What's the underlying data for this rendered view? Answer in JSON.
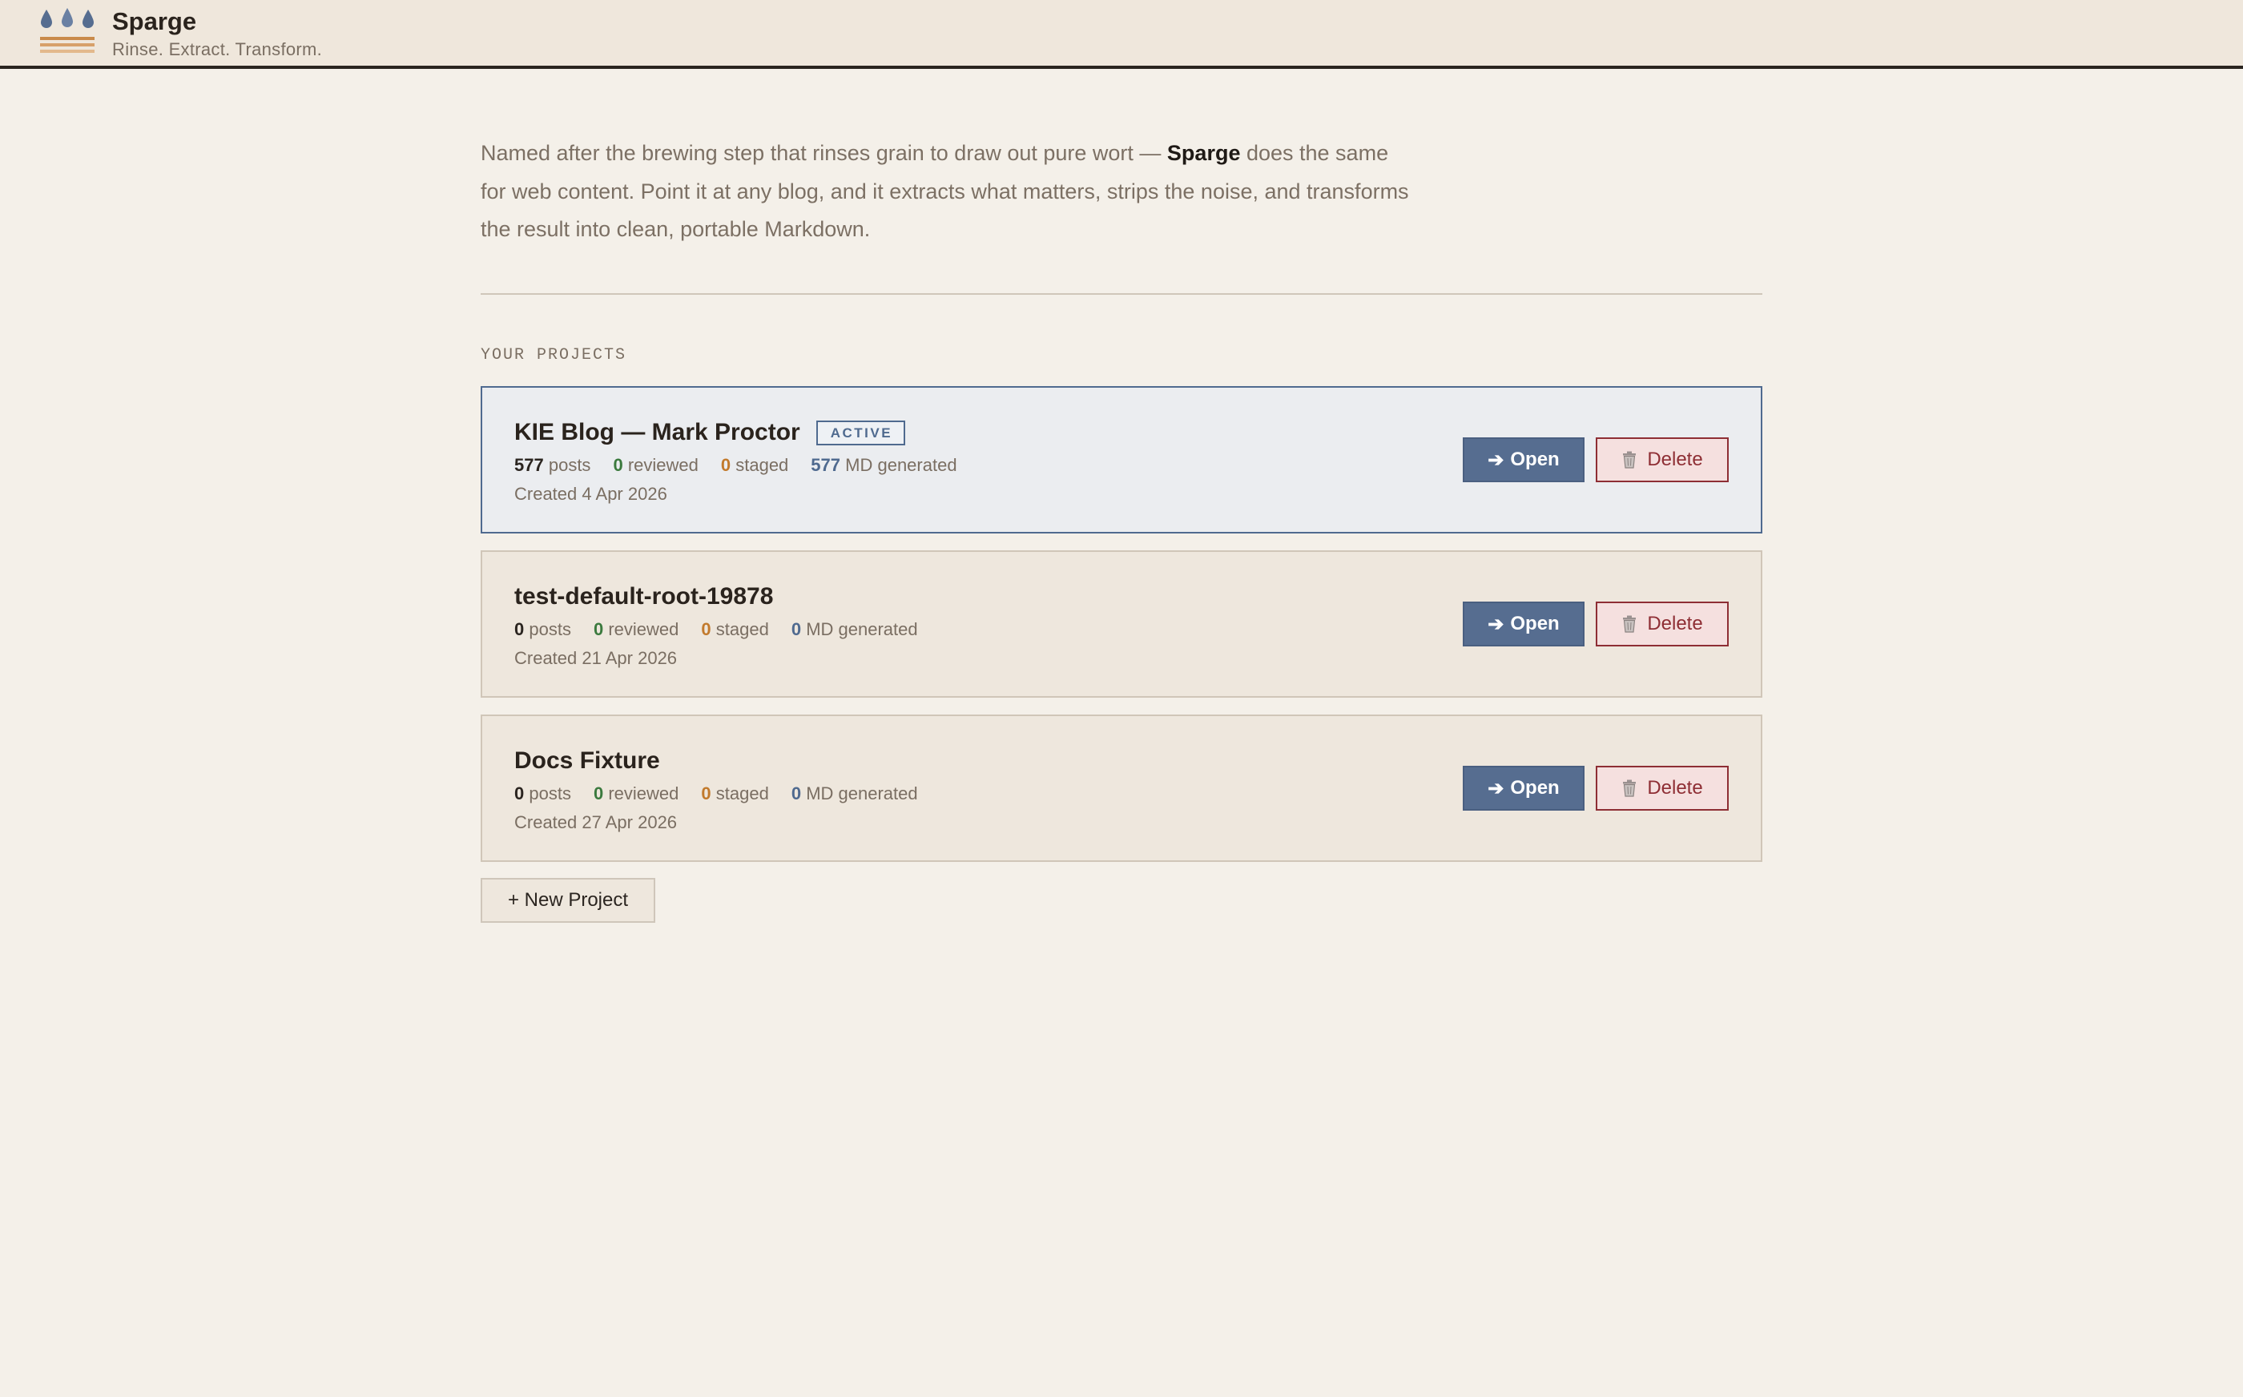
{
  "header": {
    "title": "Sparge",
    "tagline": "Rinse. Extract. Transform."
  },
  "intro": {
    "text_before": "Named after the brewing step that rinses grain to draw out pure wort — ",
    "brand": "Sparge",
    "text_after": " does the same for web content. Point it at any blog, and it extracts what matters, strips the noise, and transforms the result into clean, portable Markdown."
  },
  "section_label": "YOUR PROJECTS",
  "projects": [
    {
      "title": "KIE Blog — Mark Proctor",
      "badge": "ACTIVE",
      "posts": "577",
      "posts_label": "posts",
      "reviewed": "0",
      "reviewed_label": "reviewed",
      "staged": "0",
      "staged_label": "staged",
      "md": "577",
      "md_label": "MD generated",
      "created": "Created 4 Apr 2026",
      "open_label": "Open",
      "delete_label": "Delete"
    },
    {
      "title": "test-default-root-19878",
      "badge": "",
      "posts": "0",
      "posts_label": "posts",
      "reviewed": "0",
      "reviewed_label": "reviewed",
      "staged": "0",
      "staged_label": "staged",
      "md": "0",
      "md_label": "MD generated",
      "created": "Created 21 Apr 2026",
      "open_label": "Open",
      "delete_label": "Delete"
    },
    {
      "title": "Docs Fixture",
      "badge": "",
      "posts": "0",
      "posts_label": "posts",
      "reviewed": "0",
      "reviewed_label": "reviewed",
      "staged": "0",
      "staged_label": "staged",
      "md": "0",
      "md_label": "MD generated",
      "created": "Created 27 Apr 2026",
      "open_label": "Open",
      "delete_label": "Delete"
    }
  ],
  "new_project_label": "+ New Project",
  "colors": {
    "accent": "#566d90",
    "danger": "#8e2e34",
    "reviewed": "#3b7a3e",
    "staged": "#c27a2c"
  }
}
